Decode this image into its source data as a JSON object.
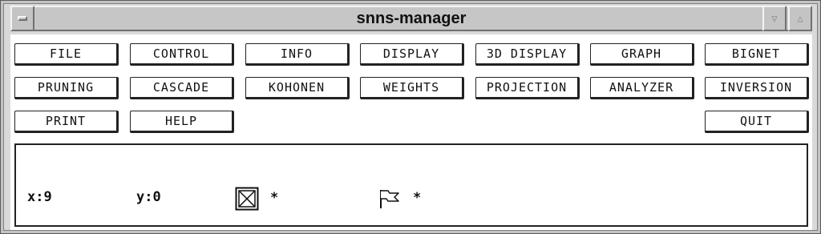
{
  "window": {
    "title": "snns-manager"
  },
  "buttons": {
    "file": "FILE",
    "control": "CONTROL",
    "info": "INFO",
    "display": "DISPLAY",
    "display3d": "3D DISPLAY",
    "graph": "GRAPH",
    "bignet": "BIGNET",
    "pruning": "PRUNING",
    "cascade": "CASCADE",
    "kohonen": "KOHONEN",
    "weights": "WEIGHTS",
    "projection": "PROJECTION",
    "analyzer": "ANALYZER",
    "inversion": "INVERSION",
    "print": "PRINT",
    "help": "HELP",
    "quit": "QUIT"
  },
  "status": {
    "x": "x:9",
    "y": "y:0",
    "unit_marker": "*",
    "flag_marker": "*"
  },
  "icons": [
    "window-menu-icon",
    "minimize-icon",
    "maximize-icon",
    "unit-box-icon",
    "flag-icon"
  ]
}
